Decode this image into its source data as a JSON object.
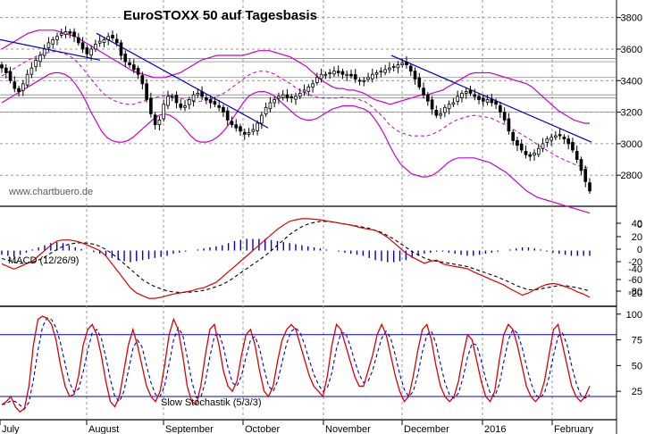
{
  "colors": {
    "bollinger": "#cc00cc",
    "trendline": "#0000cc",
    "support": "#888888",
    "candle_up": "#ffffff",
    "candle_down": "#000000",
    "macd_line": "#dd0000",
    "signal_line": "#000000",
    "histogram": "#0000cc",
    "stoch_k": "#dd0000",
    "stoch_d": "#0000cc",
    "stoch_levels": "#0000cc",
    "grid": "#9a9a9a"
  },
  "chart_data": [
    {
      "type": "candlestick",
      "title": "EuroSTOXX 50 auf Tagesbasis",
      "watermark": "www.chartbuero.de",
      "y_ticks": [
        "3800",
        "3600",
        "3400",
        "3200",
        "3000",
        "2800"
      ],
      "ylim": [
        2620,
        3900
      ],
      "grid": true,
      "months": [
        "July",
        "August",
        "September",
        "October",
        "November",
        "December",
        "2016",
        "February"
      ],
      "close": [
        3480,
        3450,
        3400,
        3350,
        3330,
        3380,
        3440,
        3480,
        3530,
        3560,
        3600,
        3640,
        3660,
        3680,
        3700,
        3710,
        3700,
        3680,
        3640,
        3600,
        3570,
        3600,
        3630,
        3650,
        3660,
        3680,
        3670,
        3640,
        3560,
        3520,
        3500,
        3470,
        3440,
        3380,
        3280,
        3190,
        3120,
        3150,
        3250,
        3300,
        3300,
        3260,
        3230,
        3240,
        3280,
        3310,
        3320,
        3300,
        3280,
        3260,
        3250,
        3230,
        3200,
        3150,
        3120,
        3100,
        3080,
        3060,
        3070,
        3090,
        3130,
        3180,
        3230,
        3260,
        3280,
        3300,
        3310,
        3290,
        3290,
        3300,
        3320,
        3340,
        3360,
        3380,
        3420,
        3440,
        3440,
        3450,
        3460,
        3450,
        3440,
        3440,
        3430,
        3410,
        3400,
        3400,
        3420,
        3440,
        3450,
        3460,
        3470,
        3480,
        3490,
        3500,
        3510,
        3500,
        3460,
        3410,
        3360,
        3310,
        3270,
        3220,
        3180,
        3190,
        3230,
        3250,
        3260,
        3300,
        3320,
        3330,
        3320,
        3300,
        3280,
        3270,
        3280,
        3260,
        3250,
        3200,
        3150,
        3080,
        3020,
        2990,
        2960,
        2930,
        2920,
        2940,
        2970,
        3000,
        3030,
        3040,
        3050,
        3050,
        3030,
        3000,
        2960,
        2900,
        2830,
        2760,
        2700
      ],
      "bb_upper": [
        3600,
        3620,
        3640,
        3660,
        3680,
        3700,
        3710,
        3720,
        3720,
        3720,
        3720,
        3710,
        3700,
        3690,
        3680,
        3660,
        3640,
        3620,
        3600,
        3580,
        3560,
        3540,
        3520,
        3500,
        3480,
        3460,
        3450,
        3440,
        3430,
        3420,
        3420,
        3420,
        3430,
        3440,
        3450,
        3470,
        3490,
        3510,
        3530,
        3540,
        3550,
        3560,
        3560,
        3560,
        3560,
        3560,
        3560,
        3570,
        3580,
        3590,
        3590,
        3590,
        3580,
        3570,
        3560,
        3550,
        3530,
        3510,
        3490,
        3460,
        3430,
        3400,
        3380,
        3360,
        3350,
        3350,
        3340,
        3340,
        3330,
        3320,
        3300,
        3280,
        3270,
        3260,
        3250,
        3260,
        3270,
        3280,
        3290,
        3300,
        3310,
        3310,
        3320,
        3330,
        3340,
        3360,
        3380,
        3400,
        3420,
        3440,
        3450,
        3450,
        3450,
        3450,
        3440,
        3430,
        3420,
        3410,
        3400,
        3390,
        3380,
        3360,
        3330,
        3300,
        3270,
        3240,
        3210,
        3190,
        3170,
        3150,
        3140,
        3130,
        3130
      ],
      "bb_lower": [
        3260,
        3280,
        3300,
        3320,
        3340,
        3360,
        3380,
        3400,
        3420,
        3440,
        3450,
        3450,
        3440,
        3420,
        3380,
        3330,
        3270,
        3200,
        3140,
        3080,
        3040,
        3020,
        3010,
        3010,
        3020,
        3040,
        3070,
        3100,
        3130,
        3160,
        3180,
        3190,
        3180,
        3160,
        3130,
        3090,
        3050,
        3020,
        3010,
        3010,
        3020,
        3040,
        3070,
        3110,
        3160,
        3210,
        3260,
        3300,
        3320,
        3330,
        3330,
        3320,
        3300,
        3270,
        3240,
        3210,
        3180,
        3160,
        3150,
        3150,
        3160,
        3180,
        3200,
        3220,
        3230,
        3240,
        3240,
        3240,
        3230,
        3220,
        3200,
        3160,
        3110,
        3050,
        2980,
        2920,
        2870,
        2840,
        2810,
        2800,
        2790,
        2790,
        2800,
        2820,
        2850,
        2880,
        2900,
        2910,
        2910,
        2910,
        2910,
        2900,
        2890,
        2880,
        2860,
        2840,
        2820,
        2790,
        2760,
        2730,
        2700,
        2680,
        2660,
        2650,
        2640,
        2630,
        2620,
        2610,
        2600,
        2590,
        2580,
        2570,
        2560
      ]
    },
    {
      "type": "line",
      "label": "MACD (12/26/9)",
      "y_ticks": [
        "40",
        "20",
        "0",
        "-20",
        "-60",
        "-80",
        "-40",
        "-20",
        "0"
      ],
      "ylim": [
        -100,
        75
      ],
      "series": {
        "macd": [
          -25,
          -30,
          -35,
          -30,
          -25,
          -20,
          -10,
          0,
          10,
          18,
          20,
          20,
          18,
          15,
          10,
          5,
          0,
          -10,
          -25,
          -40,
          -55,
          -70,
          -80,
          -85,
          -90,
          -90,
          -88,
          -85,
          -82,
          -80,
          -78,
          -76,
          -72,
          -70,
          -65,
          -60,
          -50,
          -40,
          -30,
          -20,
          -10,
          0,
          10,
          20,
          30,
          40,
          48,
          55,
          58,
          60,
          60,
          59,
          58,
          56,
          54,
          52,
          50,
          48,
          45,
          42,
          40,
          38,
          32,
          25,
          15,
          5,
          -5,
          -12,
          -18,
          -24,
          -20,
          -18,
          -25,
          -28,
          -30,
          -32,
          -34,
          -40,
          -45,
          -50,
          -55,
          -60,
          -65,
          -72,
          -78,
          -84,
          -80,
          -74,
          -68,
          -64,
          -62,
          -64,
          -68,
          -72,
          -78,
          -82,
          -88
        ],
        "signal": [
          -15,
          -18,
          -22,
          -24,
          -24,
          -22,
          -18,
          -12,
          -5,
          2,
          8,
          12,
          14,
          15,
          14,
          12,
          8,
          2,
          -6,
          -15,
          -25,
          -35,
          -45,
          -55,
          -62,
          -68,
          -72,
          -76,
          -78,
          -79,
          -79,
          -78,
          -77,
          -75,
          -72,
          -68,
          -64,
          -58,
          -50,
          -42,
          -34,
          -26,
          -18,
          -10,
          0,
          10,
          20,
          30,
          38,
          45,
          50,
          53,
          55,
          55,
          54,
          52,
          50,
          48,
          46,
          44,
          42,
          38,
          34,
          28,
          22,
          14,
          6,
          -2,
          -8,
          -14,
          -18,
          -20,
          -22,
          -24,
          -26,
          -28,
          -30,
          -34,
          -38,
          -42,
          -46,
          -50,
          -55,
          -60,
          -66,
          -70,
          -74,
          -74,
          -72,
          -70,
          -68,
          -66,
          -66,
          -68,
          -70,
          -73,
          -76
        ],
        "histogram": [
          -8,
          -10,
          -12,
          -8,
          -4,
          2,
          6,
          10,
          14,
          16,
          14,
          10,
          6,
          3,
          0,
          -3,
          -6,
          -10,
          -14,
          -18,
          -20,
          -22,
          -20,
          -18,
          -16,
          -14,
          -12,
          -10,
          -6,
          -4,
          -2,
          0,
          2,
          4,
          6,
          8,
          10,
          14,
          18,
          20,
          22,
          22,
          22,
          22,
          20,
          18,
          16,
          14,
          12,
          10,
          8,
          6,
          4,
          2,
          0,
          -2,
          -4,
          -6,
          -8,
          -10,
          -14,
          -18,
          -20,
          -22,
          -22,
          -20,
          -18,
          -14,
          -10,
          -6,
          -4,
          -2,
          -2,
          -4,
          -6,
          -8,
          -10,
          -10,
          -8,
          -6,
          -4,
          -2,
          0,
          2,
          4,
          6,
          6,
          4,
          2,
          -2,
          -4,
          -6,
          -8,
          -10,
          -10,
          -10,
          -10
        ]
      }
    },
    {
      "type": "line",
      "label": "Slow Stochastik (5/3/3)",
      "y_ticks": [
        "100",
        "75",
        "50",
        "25"
      ],
      "levels": [
        80,
        20
      ],
      "ylim": [
        0,
        105
      ],
      "series": {
        "k": [
          12,
          15,
          20,
          10,
          5,
          8,
          30,
          70,
          95,
          98,
          96,
          90,
          75,
          50,
          30,
          20,
          22,
          40,
          70,
          85,
          90,
          80,
          60,
          35,
          15,
          10,
          20,
          45,
          70,
          85,
          70,
          50,
          30,
          20,
          15,
          25,
          50,
          80,
          95,
          85,
          60,
          30,
          15,
          12,
          30,
          60,
          85,
          90,
          70,
          45,
          30,
          25,
          35,
          60,
          80,
          85,
          70,
          45,
          25,
          20,
          30,
          55,
          75,
          85,
          90,
          85,
          70,
          55,
          40,
          30,
          25,
          20,
          40,
          70,
          90,
          85,
          70,
          55,
          40,
          30,
          30,
          45,
          60,
          80,
          90,
          80,
          60,
          40,
          25,
          15,
          20,
          40,
          65,
          85,
          90,
          75,
          50,
          30,
          20,
          15,
          20,
          35,
          60,
          80,
          75,
          55,
          35,
          20,
          15,
          25,
          55,
          80,
          90,
          85,
          70,
          50,
          30,
          20,
          15,
          20,
          35,
          60,
          85,
          90,
          70,
          50,
          30,
          20,
          15,
          20,
          30
        ]
      }
    }
  ],
  "x_labels": [
    "July",
    "August",
    "September",
    "October",
    "November",
    "December",
    "2016",
    "February"
  ]
}
